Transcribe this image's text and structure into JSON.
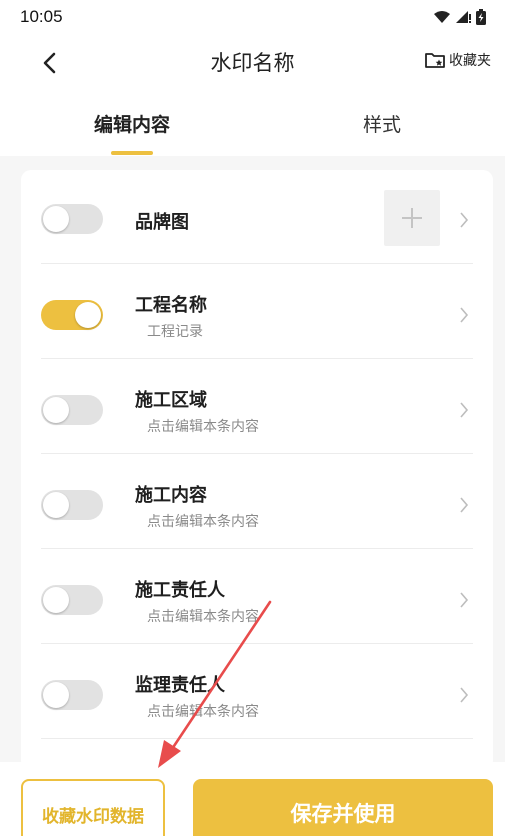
{
  "status_bar": {
    "time": "10:05"
  },
  "nav": {
    "title": "水印名称",
    "favorites_label": "收藏夹"
  },
  "tabs": [
    {
      "label": "编辑内容",
      "active": true
    },
    {
      "label": "样式",
      "active": false
    }
  ],
  "items": [
    {
      "title": "品牌图",
      "subtitle": "",
      "enabled": false,
      "has_add": true
    },
    {
      "title": "工程名称",
      "subtitle": "工程记录",
      "enabled": true
    },
    {
      "title": "施工区域",
      "subtitle": "点击编辑本条内容",
      "enabled": false
    },
    {
      "title": "施工内容",
      "subtitle": "点击编辑本条内容",
      "enabled": false
    },
    {
      "title": "施工责任人",
      "subtitle": "点击编辑本条内容",
      "enabled": false
    },
    {
      "title": "监理责任人",
      "subtitle": "点击编辑本条内容",
      "enabled": false
    }
  ],
  "buttons": {
    "collect_label": "收藏水印数据",
    "save_label": "保存并使用"
  },
  "colors": {
    "accent": "#EDC040",
    "annotation_arrow": "#E84C4C"
  }
}
